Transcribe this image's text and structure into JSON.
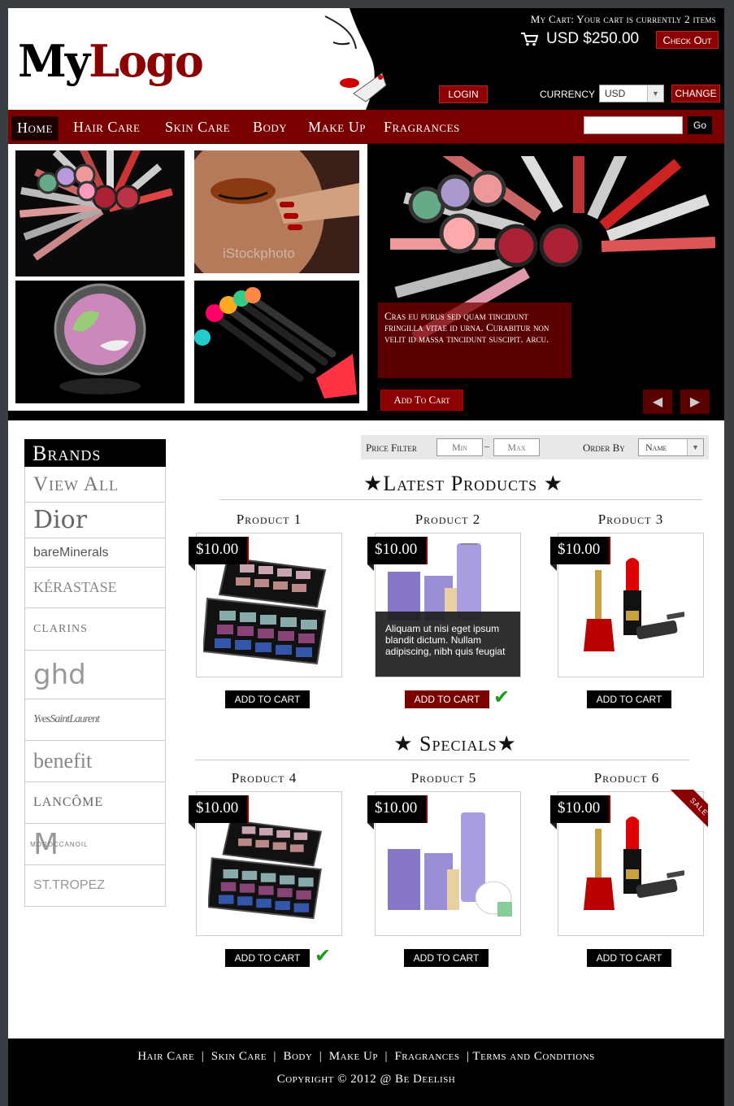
{
  "header": {
    "logo_part1": "My",
    "logo_part2": "Logo",
    "cart_summary": "My Cart: Your cart is currently 2 items",
    "cart_total": "USD $250.00",
    "checkout_label": "Check Out",
    "login_label": "LOGIN",
    "currency_label": "CURRENCY",
    "currency_value": "USD",
    "change_label": "CHANGE"
  },
  "nav": {
    "items": [
      "Home",
      "Hair Care",
      "Skin Care",
      "Body",
      "Make Up",
      "Fragrances"
    ],
    "search_placeholder": "",
    "go_label": "Go"
  },
  "hero": {
    "caption": "Cras eu purus sed quam tincidunt fringilla vitae id urna. Curabitur non velit id massa tincidunt suscipit. arcu.",
    "add_to_cart": "Add To Cart",
    "watermark": "iStockphoto"
  },
  "sidebar": {
    "title": "Brands",
    "view_all": "View All",
    "brands": [
      "Dior",
      "bareMinerals",
      "KÉRASTASE",
      "CLARINS",
      "ghd",
      "YvesSaintLaurent",
      "benefit",
      "LANCÔME",
      "MOROCCANOIL",
      "ST.TROPEZ"
    ]
  },
  "filter": {
    "price_filter_label": "Price Filter",
    "min_placeholder": "Min",
    "dash": "–",
    "max_placeholder": "Max",
    "order_by_label": "Order By",
    "order_by_value": "Name"
  },
  "latest": {
    "title": "Latest Products",
    "products": [
      {
        "name": "Product 1",
        "price": "$10.00",
        "cta": "ADD TO CART"
      },
      {
        "name": "Product 2",
        "price": "$10.00",
        "cta": "ADD TO CART",
        "description": "Aliquam ut nisi eget ipsum blandit dictum. Nullam adipiscing, nibh quis feugiat"
      },
      {
        "name": "Product 3",
        "price": "$10.00",
        "cta": "ADD TO CART"
      }
    ]
  },
  "specials": {
    "title": "Specials",
    "products": [
      {
        "name": "Product 4",
        "price": "$10.00",
        "cta": "ADD TO CART"
      },
      {
        "name": "Product 5",
        "price": "$10.00",
        "cta": "ADD TO CART"
      },
      {
        "name": "Product 6",
        "price": "$10.00",
        "cta": "ADD TO CART",
        "badge": "SALE"
      }
    ]
  },
  "footer": {
    "links": [
      "Hair Care",
      "Skin Care",
      "Body",
      "Make Up",
      "Fragrances",
      "Terms and Conditions"
    ],
    "copyright": "Copyright © 2012 @ Be Deelish"
  },
  "colors": {
    "accent": "#8b0000",
    "dark": "#000000",
    "check": "#1a9a1a"
  }
}
